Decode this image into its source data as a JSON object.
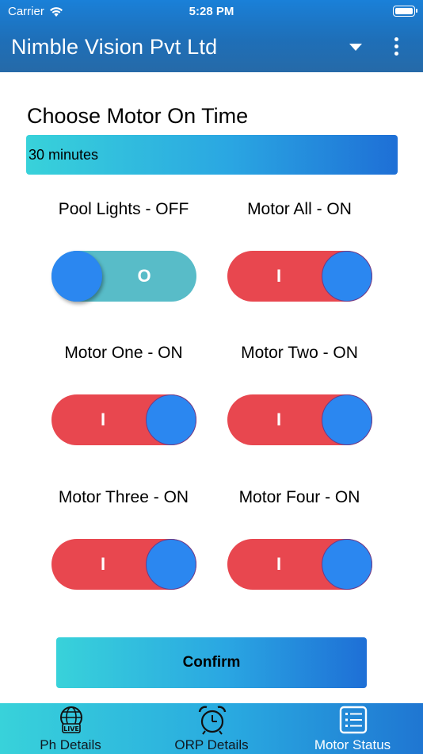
{
  "status_bar": {
    "carrier": "Carrier",
    "time": "5:28 PM"
  },
  "app_bar": {
    "title": "Nimble Vision Pvt Ltd"
  },
  "motor_time": {
    "heading": "Choose Motor On Time",
    "selected": "30 minutes"
  },
  "toggles": [
    {
      "label": "Pool Lights - OFF",
      "state": "off",
      "glyph": "O"
    },
    {
      "label": "Motor All - ON",
      "state": "on",
      "glyph": "I"
    },
    {
      "label": "Motor One - ON",
      "state": "on",
      "glyph": "I"
    },
    {
      "label": "Motor Two - ON",
      "state": "on",
      "glyph": "I"
    },
    {
      "label": "Motor Three - ON",
      "state": "on",
      "glyph": "I"
    },
    {
      "label": "Motor Four - ON",
      "state": "on",
      "glyph": "I"
    }
  ],
  "confirm_label": "Confirm",
  "bottom_nav": [
    {
      "label": "Ph Details",
      "icon": "globe-live-icon",
      "active": false
    },
    {
      "label": "ORP Details",
      "icon": "alarm-clock-icon",
      "active": false
    },
    {
      "label": "Motor Status",
      "icon": "list-icon",
      "active": true
    }
  ],
  "colors": {
    "header": "#1e6fb8",
    "toggle_on": "#e8474f",
    "toggle_off": "#58bcc8",
    "knob": "#2b87f0",
    "gradient_start": "#38d2da",
    "gradient_end": "#1e6fd6"
  }
}
